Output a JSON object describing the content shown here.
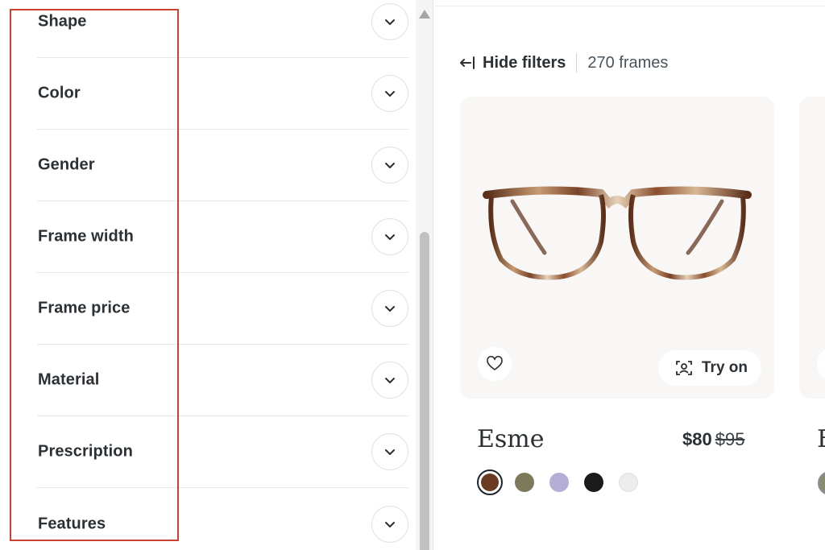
{
  "filters": {
    "items": [
      {
        "label": "Shape"
      },
      {
        "label": "Color"
      },
      {
        "label": "Gender"
      },
      {
        "label": "Frame width"
      },
      {
        "label": "Frame price"
      },
      {
        "label": "Material"
      },
      {
        "label": "Prescription"
      },
      {
        "label": "Features"
      }
    ],
    "expand_icon": "chevron-down-icon"
  },
  "toolbar": {
    "hide_filters_label": "Hide filters",
    "hide_filters_icon": "arrow-left-bar-icon",
    "count_label": "270 frames"
  },
  "product": {
    "name": "Esme",
    "price": "$80",
    "original_price": "$95",
    "favorite_icon": "heart-icon",
    "try_on_label": "Try on",
    "try_on_icon": "face-scan-icon",
    "swatches": [
      {
        "color": "#6b3a22",
        "selected": true
      },
      {
        "color": "#7c7a5a",
        "selected": false
      },
      {
        "color": "#b4aed4",
        "selected": false
      },
      {
        "color": "#1a1a1a",
        "selected": false
      },
      {
        "color": "#ececec",
        "selected": false
      }
    ]
  },
  "next_product": {
    "name_initial": "E"
  },
  "colors": {
    "highlight_box": "#c9412f",
    "text": "#2b3035",
    "card_bg": "#f8f7f6"
  }
}
